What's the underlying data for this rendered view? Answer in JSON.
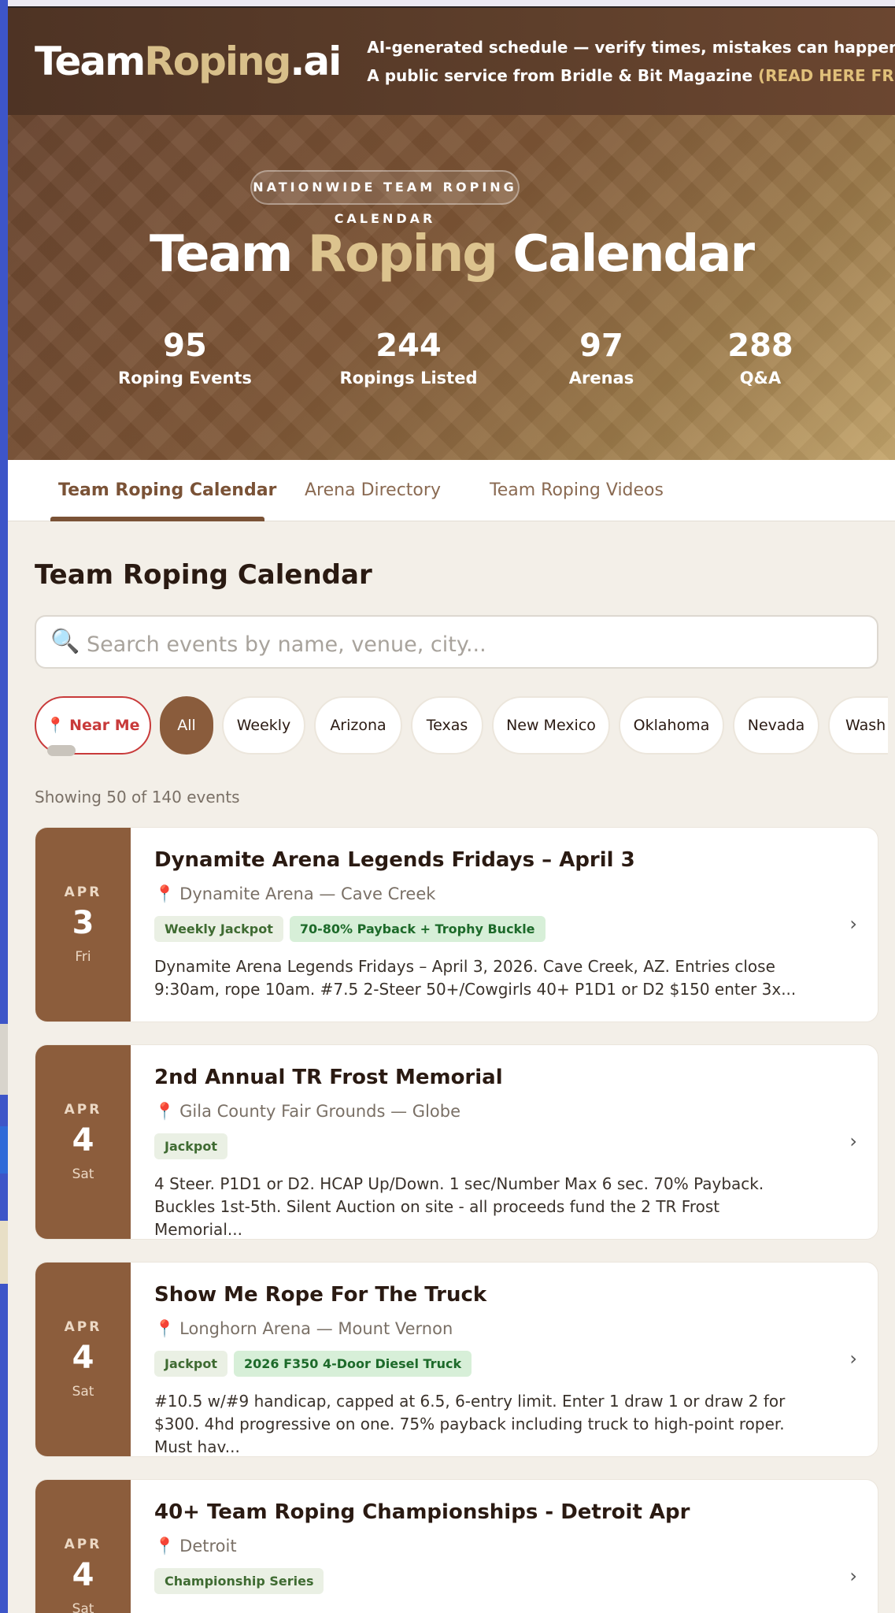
{
  "header": {
    "logo_part1": "Team",
    "logo_part2": "Roping",
    "logo_part3": ".ai",
    "line1": "AI-generated schedule — verify times, mistakes can happen",
    "line2": "A public service from Bridle & Bit Magazine",
    "link": "(READ HERE FREE)"
  },
  "hero": {
    "pill": "NATIONWIDE TEAM ROPING CALENDAR",
    "title_part1": "Team",
    "title_part2": "Roping",
    "title_part3": "Calendar",
    "stats": [
      {
        "num": "95",
        "label": "Roping Events"
      },
      {
        "num": "244",
        "label": "Ropings Listed"
      },
      {
        "num": "97",
        "label": "Arenas"
      },
      {
        "num": "288",
        "label": "Q&A"
      }
    ]
  },
  "tabs": [
    "Team Roping Calendar",
    "Arena Directory",
    "Team Roping Videos"
  ],
  "main": {
    "title": "Team Roping Calendar",
    "search_placeholder": "Search events by name, venue, city...",
    "filters": [
      "Near Me",
      "All",
      "Weekly",
      "Arizona",
      "Texas",
      "New Mexico",
      "Oklahoma",
      "Nevada",
      "Wash"
    ],
    "count": "Showing 50 of 140 events"
  },
  "events": [
    {
      "month": "APR",
      "day": "3",
      "weekday": "Fri",
      "title": "Dynamite Arena Legends Fridays – April 3",
      "venue": "Dynamite Arena — Cave Creek",
      "tags": [
        "Weekly Jackpot",
        "70-80% Payback + Trophy Buckle"
      ],
      "desc": "Dynamite Arena Legends Fridays – April 3, 2026. Cave Creek, AZ. Entries close 9:30am, rope 10am. #7.5 2-Steer 50+/Cowgirls 40+ P1D1 or D2 $150 enter 3x..."
    },
    {
      "month": "APR",
      "day": "4",
      "weekday": "Sat",
      "title": "2nd Annual TR Frost Memorial",
      "venue": "Gila County Fair Grounds — Globe",
      "tags": [
        "Jackpot"
      ],
      "desc": "4 Steer. P1D1 or D2. HCAP Up/Down. 1 sec/Number Max 6 sec. 70% Payback. Buckles 1st-5th. Silent Auction on site - all proceeds fund the 2 TR Frost Memorial..."
    },
    {
      "month": "APR",
      "day": "4",
      "weekday": "Sat",
      "title": "Show Me Rope For The Truck",
      "venue": "Longhorn Arena — Mount Vernon",
      "tags": [
        "Jackpot",
        "2026 F350 4-Door Diesel Truck"
      ],
      "desc": "#10.5 w/#9 handicap, capped at 6.5, 6-entry limit. Enter 1 draw 1 or draw 2 for $300. 4hd progressive on one. 75% payback including truck to high-point roper. Must hav..."
    },
    {
      "month": "APR",
      "day": "4",
      "weekday": "Sat",
      "title": "40+ Team Roping Championships - Detroit Apr",
      "venue": "Detroit",
      "tags": [
        "Championship Series"
      ],
      "desc": ""
    }
  ],
  "icons": {
    "search": "magnifier-icon",
    "pin": "map-pin-icon",
    "chevron": "chevron-right-icon"
  },
  "colors": {
    "brand_brown": "#8c5d3c",
    "gold": "#dcc38e",
    "near_me_red": "#c83a3a",
    "tag_green": "#d7efd8"
  }
}
